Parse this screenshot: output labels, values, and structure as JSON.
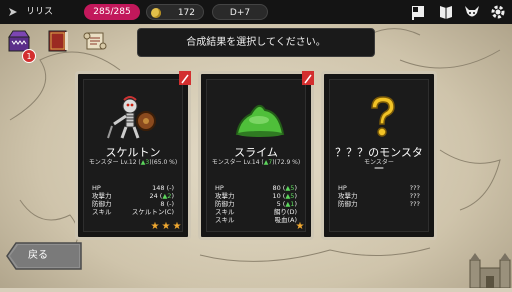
{
  "topbar": {
    "player_name": "リリス",
    "hp": "285/285",
    "gold": "172",
    "day": "D+7",
    "icons": [
      "flag-icon",
      "book-icon",
      "demon-icon",
      "settings-icon"
    ]
  },
  "left_icons": [
    "mimic-chest-icon",
    "spellbook-icon",
    "scroll-icon"
  ],
  "notification_count": "1",
  "banner": {
    "text": "合成結果を選択してください。"
  },
  "cards": [
    {
      "name": "スケルトン",
      "subtitle_prefix": "モンスター Lv.12 (",
      "subtitle_up": "▲3",
      "subtitle_suffix": ")(65.0 %)",
      "stats": [
        {
          "label": "HP",
          "value": "148 (-)",
          "up": ""
        },
        {
          "label": "攻撃力",
          "value_prefix": "24 (",
          "up": "▲2",
          "value_suffix": ")"
        },
        {
          "label": "防御力",
          "value": "8 (-)",
          "up": ""
        },
        {
          "label": "スキル",
          "value": "スケルトン(C)",
          "up": ""
        }
      ],
      "stars": 3,
      "color": "#cfc7b4"
    },
    {
      "name": "スライム",
      "subtitle_prefix": "モンスター Lv.14 (",
      "subtitle_up": "▲7",
      "subtitle_suffix": ")(72.9 %)",
      "stats": [
        {
          "label": "HP",
          "value_prefix": "80 (",
          "up": "▲5",
          "value_suffix": ")"
        },
        {
          "label": "攻撃力",
          "value_prefix": "10 (",
          "up": "▲5",
          "value_suffix": ")"
        },
        {
          "label": "防御力",
          "value_prefix": "5 (",
          "up": "▲1",
          "value_suffix": ")"
        },
        {
          "label": "スキル",
          "value": "餌り(D)",
          "up": ""
        },
        {
          "label": "スキル",
          "value": "吸血(A)",
          "up": ""
        }
      ],
      "stars": 1
    },
    {
      "name": "？？？のモンスター",
      "subtitle": "モンスター",
      "stats": [
        {
          "label": "HP",
          "value": "???"
        },
        {
          "label": "攻撃力",
          "value": "???"
        },
        {
          "label": "防御力",
          "value": "???"
        }
      ],
      "stars": 0
    }
  ],
  "back_button": {
    "label": "戻る"
  }
}
